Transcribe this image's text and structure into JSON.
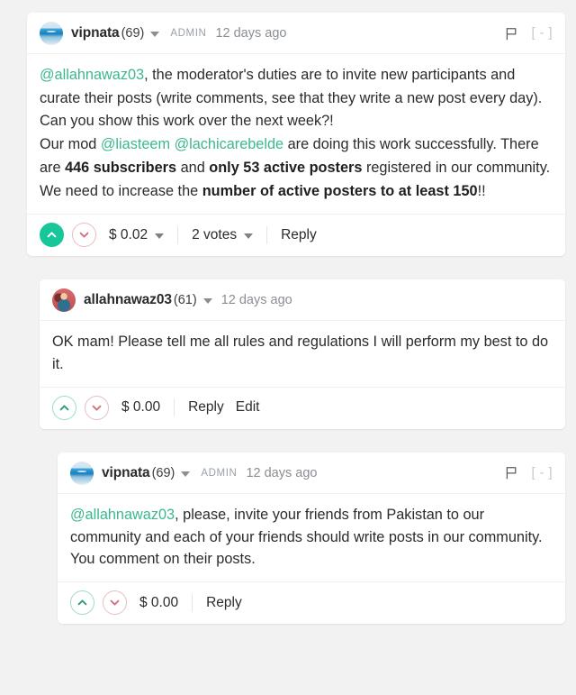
{
  "theme": {
    "page_background": "#f2f2f2",
    "card_background": "#ffffff",
    "mention_color": "#3bb890",
    "upvote_active_color": "#17c79a",
    "downvote_color": "#d4737f",
    "muted_text_color": "#8a8f94"
  },
  "comments": [
    {
      "level": 0,
      "avatar_icon": "sea-photo-avatar",
      "username": "vipnata",
      "reputation": "(69)",
      "role_badge": "ADMIN",
      "timestamp": "12 days ago",
      "flag_icon": "flag-icon",
      "collapse_label": "[ - ]",
      "body_segments": [
        {
          "type": "mention",
          "text": "@allahnawaz03"
        },
        {
          "type": "text",
          "text": ", the moderator's duties are to invite new participants and curate their posts (write comments, see that they write a new post every day). Can you show this work over the next week?!"
        },
        {
          "type": "break",
          "text": ""
        },
        {
          "type": "text",
          "text": "Our mod "
        },
        {
          "type": "mention",
          "text": "@liasteem"
        },
        {
          "type": "text",
          "text": " "
        },
        {
          "type": "mention",
          "text": "@lachicarebelde"
        },
        {
          "type": "text",
          "text": " are doing this work successfully. There are "
        },
        {
          "type": "bold",
          "text": "446 subscribers"
        },
        {
          "type": "text",
          "text": " and "
        },
        {
          "type": "bold",
          "text": "only 53 active posters"
        },
        {
          "type": "text",
          "text": " registered in our community. We need to increase the "
        },
        {
          "type": "bold",
          "text": "number of active posters to at least 150"
        },
        {
          "type": "text",
          "text": "!!"
        }
      ],
      "upvote_state": "active",
      "downvote_state": "idle",
      "payout": "$ 0.02",
      "payout_has_caret": true,
      "votes_label": "2 votes",
      "votes_has_caret": true,
      "actions": [
        "Reply"
      ]
    },
    {
      "level": 1,
      "avatar_icon": "portrait-photo-avatar",
      "username": "allahnawaz03",
      "reputation": "(61)",
      "role_badge": "",
      "timestamp": "12 days ago",
      "flag_icon": "",
      "collapse_label": "",
      "body_segments": [
        {
          "type": "text",
          "text": "OK mam! Please tell me all rules and regulations I will perform my best to do it."
        }
      ],
      "upvote_state": "idle",
      "downvote_state": "idle",
      "payout": "$ 0.00",
      "payout_has_caret": false,
      "votes_label": "",
      "votes_has_caret": false,
      "actions": [
        "Reply",
        "Edit"
      ]
    },
    {
      "level": 2,
      "avatar_icon": "sea-photo-avatar",
      "username": "vipnata",
      "reputation": "(69)",
      "role_badge": "ADMIN",
      "timestamp": "12 days ago",
      "flag_icon": "flag-icon",
      "collapse_label": "[ - ]",
      "body_segments": [
        {
          "type": "mention",
          "text": "@allahnawaz03"
        },
        {
          "type": "text",
          "text": ", please, invite your friends from Pakistan to our community and each of your friends should write posts in our community. You comment on their posts."
        }
      ],
      "upvote_state": "idle",
      "downvote_state": "idle",
      "payout": "$ 0.00",
      "payout_has_caret": false,
      "votes_label": "",
      "votes_has_caret": false,
      "actions": [
        "Reply"
      ]
    }
  ]
}
